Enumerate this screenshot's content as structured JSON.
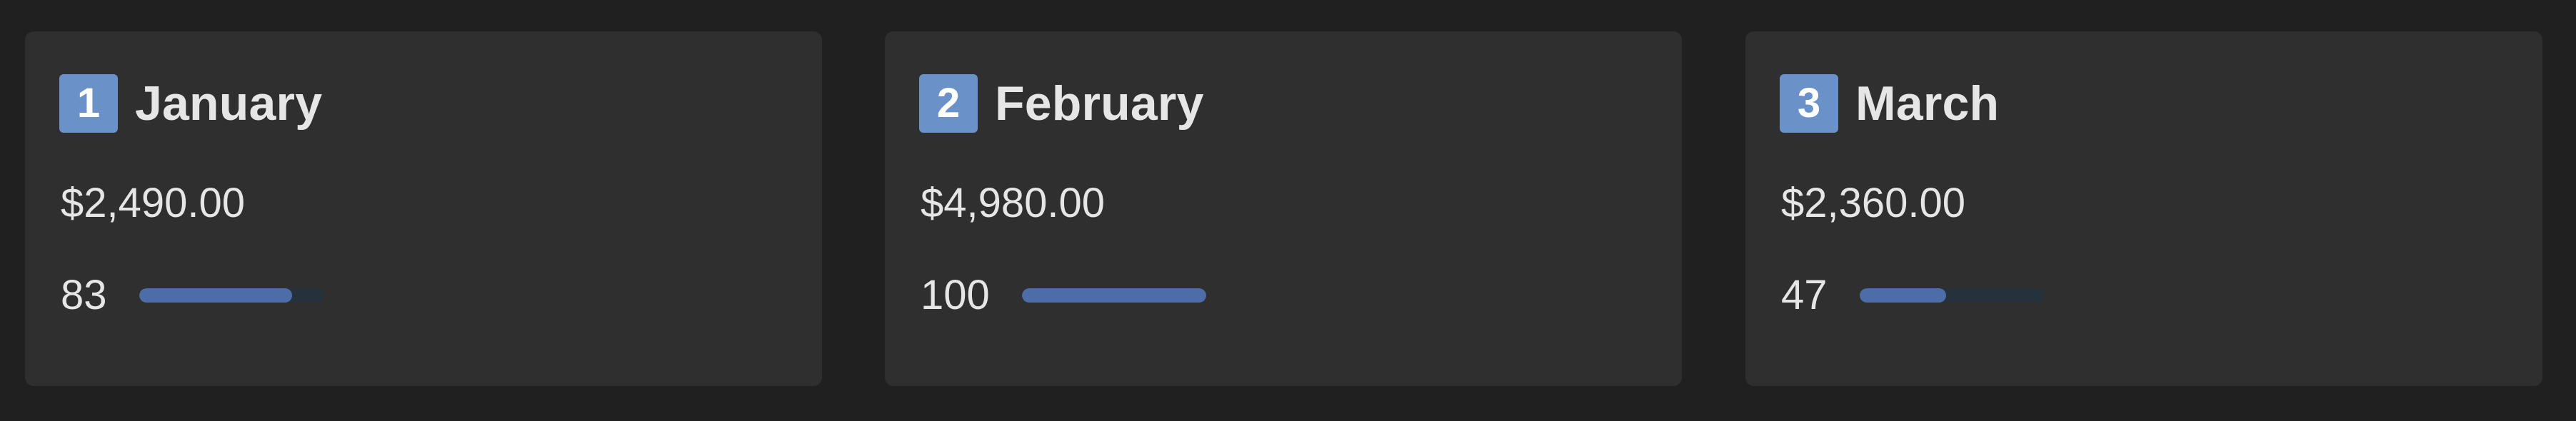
{
  "colors": {
    "page_background": "#202020",
    "card_background": "#2f2f2f",
    "text": "#e6e6e6",
    "badge": "#6a92c8",
    "progress_track": "#25323b",
    "progress_fill": "#4c6da8"
  },
  "months": [
    {
      "badge": "1",
      "badge_icon": "keycap-digit-one-icon",
      "name": "January",
      "amount": "$2,490.00",
      "progress_label": "83",
      "progress_value": 83
    },
    {
      "badge": "2",
      "badge_icon": "keycap-digit-two-icon",
      "name": "February",
      "amount": "$4,980.00",
      "progress_label": "100",
      "progress_value": 100
    },
    {
      "badge": "3",
      "badge_icon": "keycap-digit-three-icon",
      "name": "March",
      "amount": "$2,360.00",
      "progress_label": "47",
      "progress_value": 47
    }
  ]
}
